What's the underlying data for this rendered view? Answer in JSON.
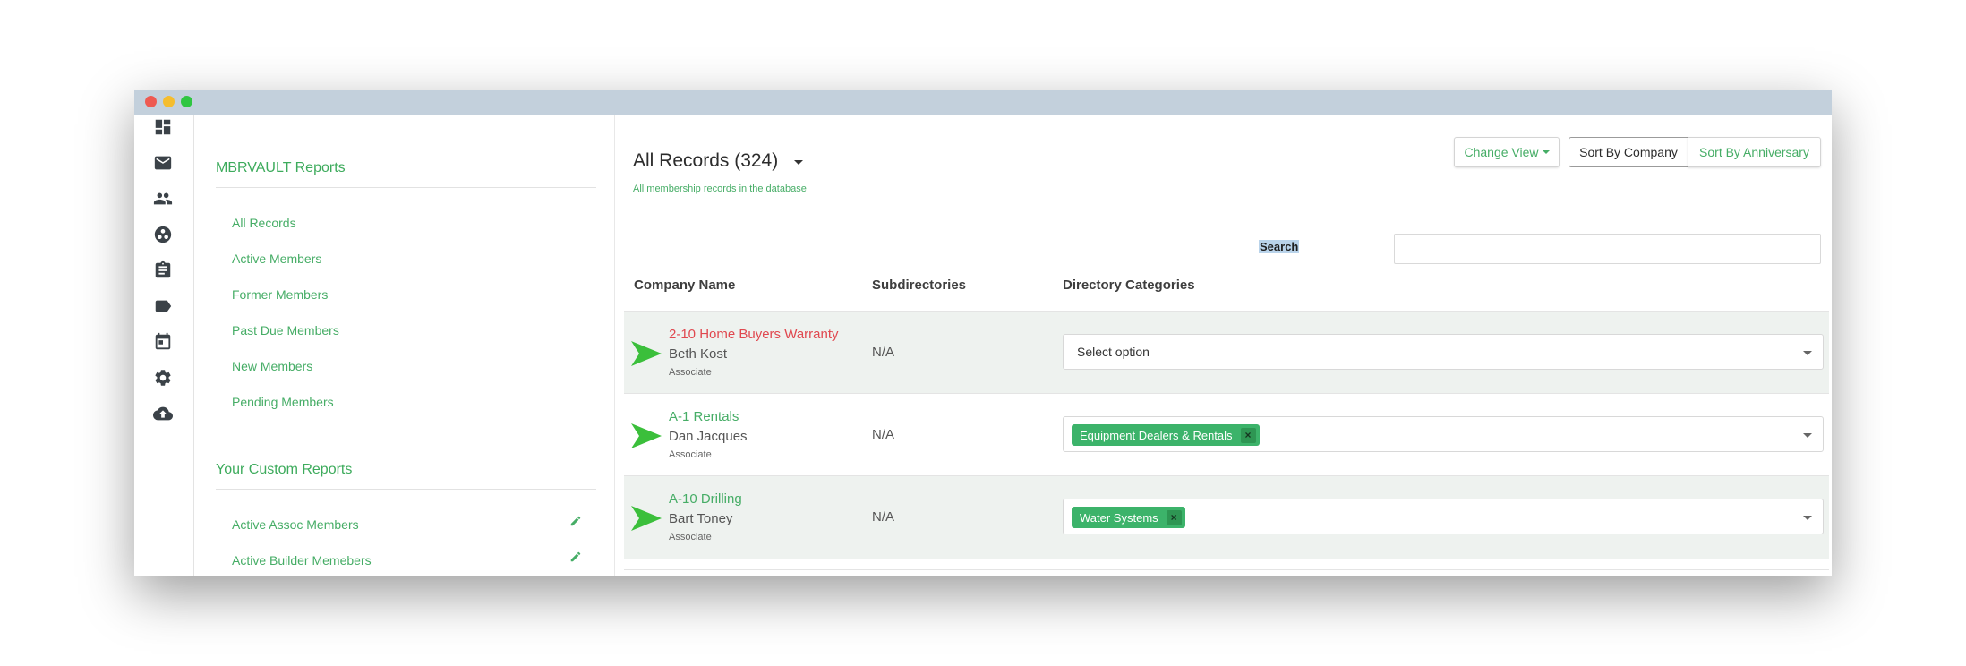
{
  "sidebar_panel": {
    "heading_reports": "MBRVAULT Reports",
    "reports": [
      {
        "label": "All Records"
      },
      {
        "label": "Active Members"
      },
      {
        "label": "Former Members"
      },
      {
        "label": "Past Due Members"
      },
      {
        "label": "New Members"
      },
      {
        "label": "Pending Members"
      }
    ],
    "heading_custom": "Your Custom Reports",
    "custom_reports": [
      {
        "label": "Active Assoc Members"
      },
      {
        "label": "Active Builder Memebers"
      }
    ]
  },
  "nav_icons": [
    "dashboard-icon",
    "mail-icon",
    "people-icon",
    "group-icon",
    "clipboard-icon",
    "label-icon",
    "calendar-icon",
    "gear-icon",
    "cloud-upload-icon"
  ],
  "main": {
    "title": "All Records (324)",
    "subtitle": "All membership records in the database",
    "change_view": "Change View",
    "sort_company": "Sort By Company",
    "sort_anniversary": "Sort By Anniversary",
    "search_label": "Search",
    "search_value": "",
    "columns": [
      "Company Name",
      "Subdirectories",
      "Directory Categories"
    ]
  },
  "rows": [
    {
      "company": "2-10 Home Buyers Warranty",
      "contact": "Beth Kost",
      "role": "Associate",
      "subdirectories": "N/A",
      "category_placeholder": "Select option"
    },
    {
      "company": "A-1 Rentals",
      "contact": "Dan Jacques",
      "role": "Associate",
      "subdirectories": "N/A",
      "category": "Equipment Dealers & Rentals",
      "remove": "×"
    },
    {
      "company": "A-10 Drilling",
      "contact": "Bart Toney",
      "role": "Associate",
      "subdirectories": "N/A",
      "category": "Water Systems",
      "remove": "×"
    }
  ],
  "colors": {
    "accent_green": "#46ad66",
    "warning_red": "#e0484f",
    "tag_green": "#3cb36a",
    "titlebar": "#c3d0dc"
  }
}
